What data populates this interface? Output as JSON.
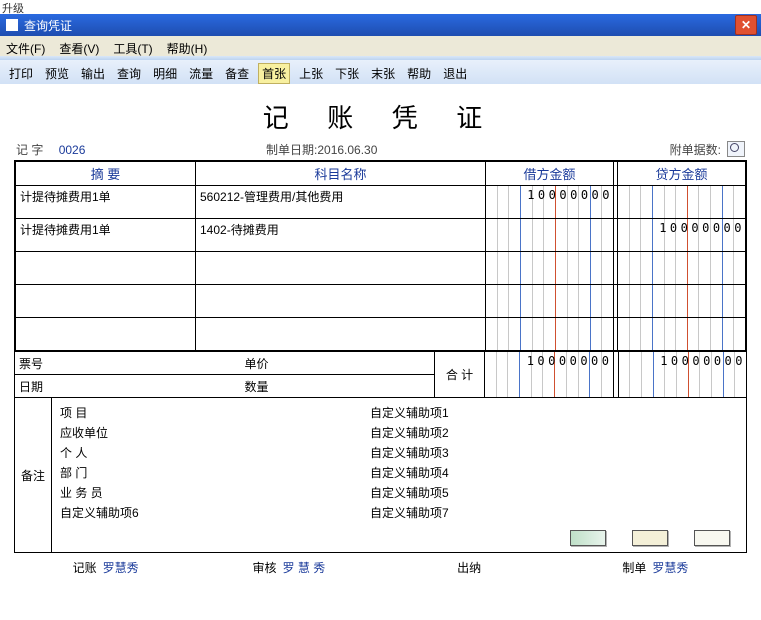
{
  "upper_label": "升级",
  "window": {
    "title": "查询凭证"
  },
  "menus": [
    {
      "label": "文件(F)"
    },
    {
      "label": "查看(V)"
    },
    {
      "label": "工具(T)"
    },
    {
      "label": "帮助(H)"
    }
  ],
  "toolbar": [
    {
      "label": "打印"
    },
    {
      "label": "预览"
    },
    {
      "label": "输出"
    },
    {
      "label": "查询"
    },
    {
      "label": "明细"
    },
    {
      "label": "流量"
    },
    {
      "label": "备查"
    },
    {
      "label": "首张",
      "active": true
    },
    {
      "label": "上张"
    },
    {
      "label": "下张"
    },
    {
      "label": "末张"
    },
    {
      "label": "帮助"
    },
    {
      "label": "退出"
    }
  ],
  "doc": {
    "title": "记 账 凭 证",
    "ji_label": "记  字",
    "no": "0026",
    "date_label": "制单日期:",
    "date": "2016.06.30",
    "attach_label": "附单据数:"
  },
  "headers": {
    "summary": "摘  要",
    "subject": "科目名称",
    "debit": "借方金额",
    "credit": "贷方金额"
  },
  "rows": [
    {
      "summary": "计提待摊费用1单",
      "subject": "560212-管理费用/其他费用",
      "debit": "10000000",
      "credit": ""
    },
    {
      "summary": "计提待摊费用1单",
      "subject": "1402-待摊费用",
      "debit": "",
      "credit": "10000000"
    },
    {
      "summary": "",
      "subject": "",
      "debit": "",
      "credit": ""
    },
    {
      "summary": "",
      "subject": "",
      "debit": "",
      "credit": ""
    },
    {
      "summary": "",
      "subject": "",
      "debit": "",
      "credit": ""
    }
  ],
  "mid": {
    "ticket_label": "票号",
    "price_label": "单价",
    "date_label": "日期",
    "qty_label": "数量",
    "total_label": "合  计",
    "debit_total": "10000000",
    "credit_total": "10000000"
  },
  "remarks": {
    "label": "备注",
    "items": [
      {
        "l": "项    目",
        "r": "自定义辅助项1"
      },
      {
        "l": "应收单位",
        "r": "自定义辅助项2"
      },
      {
        "l": "个    人",
        "r": "自定义辅助项3"
      },
      {
        "l": "部    门",
        "r": "自定义辅助项4"
      },
      {
        "l": "业 务 员",
        "r": "自定义辅助项5"
      },
      {
        "l": "自定义辅助项6",
        "r": "自定义辅助项7"
      }
    ]
  },
  "sign": {
    "book_label": "记账",
    "book_name": "罗慧秀",
    "audit_label": "审核",
    "audit_name": "罗 慧 秀",
    "cashier_label": "出纳",
    "cashier_name": "",
    "maker_label": "制单",
    "maker_name": "罗慧秀"
  }
}
